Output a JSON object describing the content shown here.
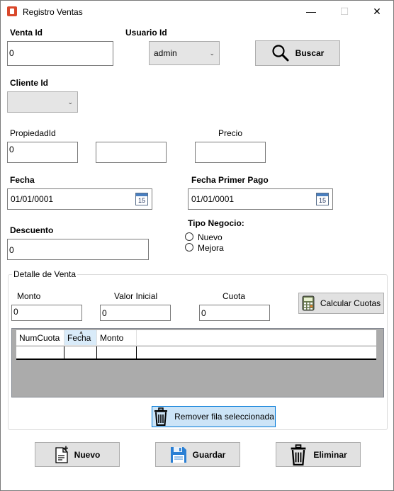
{
  "window": {
    "title": "Registro Ventas",
    "minimize_glyph": "—",
    "maximize_glyph": "☐",
    "close_glyph": "✕"
  },
  "venta": {
    "label": "Venta Id",
    "value": "0"
  },
  "usuario": {
    "label": "Usuario Id",
    "selected": "admin"
  },
  "buscar": {
    "label": "Buscar",
    "icon": "search-icon"
  },
  "cliente": {
    "label": "Cliente Id",
    "selected": ""
  },
  "propiedad": {
    "label": "PropiedadId",
    "value": "0",
    "extra_value": ""
  },
  "precio": {
    "label": "Precio",
    "value": ""
  },
  "fecha": {
    "label": "Fecha",
    "value": "01/01/0001",
    "calendar_day": "15"
  },
  "fecha_primer_pago": {
    "label": "Fecha Primer Pago",
    "value": "01/01/0001",
    "calendar_day": "15"
  },
  "descuento": {
    "label": "Descuento",
    "value": "0"
  },
  "tipo_negocio": {
    "label": "Tipo Negocio:",
    "options": [
      "Nuevo",
      "Mejora"
    ]
  },
  "detalle": {
    "title": "Detalle de Venta",
    "monto_label": "Monto",
    "monto_value": "0",
    "valor_inicial_label": "Valor Inicial",
    "valor_inicial_value": "0",
    "cuota_label": "Cuota",
    "cuota_value": "0",
    "calcular_label": "Calcular Cuotas",
    "grid_columns": [
      "NumCuota",
      "Fecha",
      "Monto"
    ],
    "remover_label": "Remover fila seleccionada"
  },
  "footer": {
    "nuevo_label": "Nuevo",
    "guardar_label": "Guardar",
    "eliminar_label": "Eliminar"
  },
  "colors": {
    "accent": "#0078d7",
    "button_bg": "#e1e1e1",
    "selected_button_bg": "#cce4f7"
  }
}
